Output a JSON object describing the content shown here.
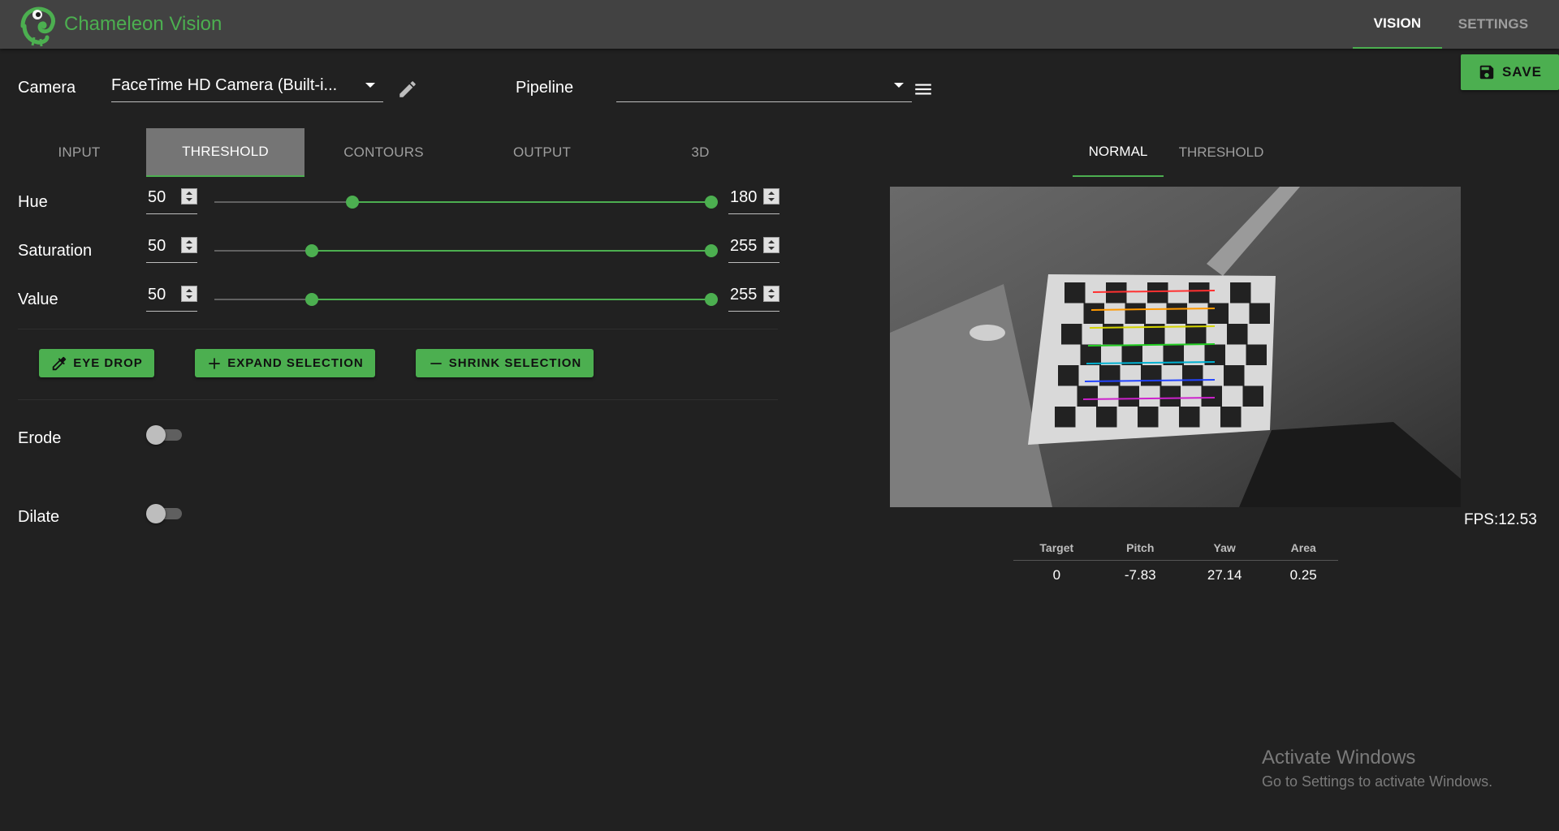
{
  "app": {
    "title": "Chameleon Vision",
    "accent": "#4caf50"
  },
  "nav": {
    "tabs": [
      {
        "label": "VISION",
        "active": true
      },
      {
        "label": "SETTINGS",
        "active": false
      }
    ]
  },
  "toolbar": {
    "save_label": "SAVE"
  },
  "camera": {
    "label": "Camera",
    "selected": "FaceTime HD Camera (Built-i..."
  },
  "pipeline": {
    "label": "Pipeline",
    "selected": ""
  },
  "tabs": [
    {
      "label": "INPUT",
      "active": false
    },
    {
      "label": "THRESHOLD",
      "active": true
    },
    {
      "label": "CONTOURS",
      "active": false
    },
    {
      "label": "OUTPUT",
      "active": false
    },
    {
      "label": "3D",
      "active": false
    }
  ],
  "ranges": [
    {
      "label": "Hue",
      "min": "50",
      "max": "180",
      "scale_max": 180
    },
    {
      "label": "Saturation",
      "min": "50",
      "max": "255",
      "scale_max": 255
    },
    {
      "label": "Value",
      "min": "50",
      "max": "255",
      "scale_max": 255
    }
  ],
  "actions": {
    "eye_drop": "EYE DROP",
    "expand": "EXPAND SELECTION",
    "shrink": "SHRINK SELECTION"
  },
  "toggles": {
    "erode": {
      "label": "Erode",
      "on": false
    },
    "dilate": {
      "label": "Dilate",
      "on": false
    }
  },
  "view_tabs": [
    {
      "label": "NORMAL",
      "active": true
    },
    {
      "label": "THRESHOLD",
      "active": false
    }
  ],
  "fps": "FPS:12.53",
  "targets": {
    "headers": [
      "Target",
      "Pitch",
      "Yaw",
      "Area"
    ],
    "rows": [
      [
        "0",
        "-7.83",
        "27.14",
        "0.25"
      ]
    ]
  },
  "watermark": {
    "title": "Activate Windows",
    "subtitle": "Go to Settings to activate Windows."
  }
}
